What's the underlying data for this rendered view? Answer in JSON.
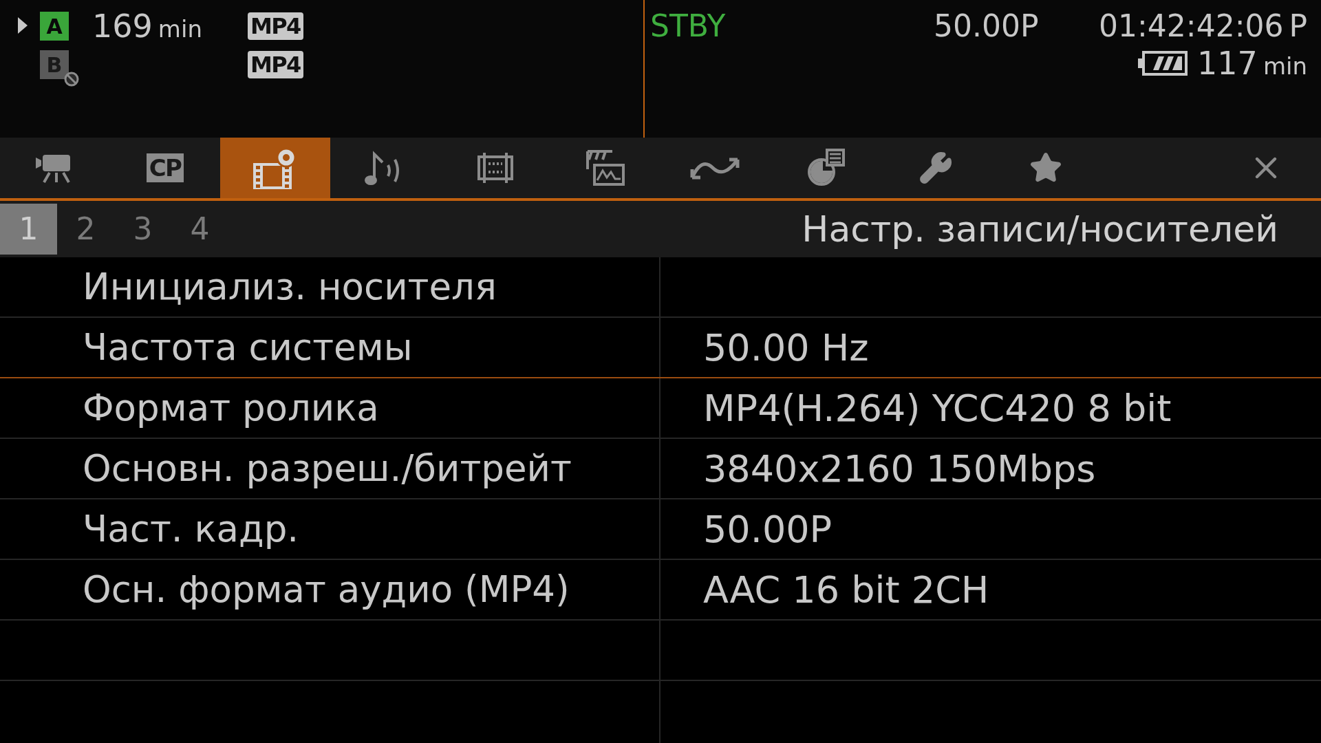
{
  "status": {
    "media": [
      {
        "slot": "A",
        "active": true,
        "disabled": false,
        "remaining": "169",
        "unit": "min",
        "format": "MP4"
      },
      {
        "slot": "B",
        "active": false,
        "disabled": true,
        "format": "MP4"
      }
    ],
    "mode": "STBY",
    "frame_rate": "50.00P",
    "timecode": "01:42:42:06",
    "timecode_suffix": "P",
    "battery": {
      "remaining": "117",
      "unit": "min"
    }
  },
  "menu_tabs": [
    {
      "kind": "camera",
      "selected": false
    },
    {
      "kind": "text",
      "label": "CP",
      "selected": false
    },
    {
      "kind": "media-settings",
      "selected": true
    },
    {
      "kind": "audio",
      "selected": false
    },
    {
      "kind": "frame",
      "selected": false
    },
    {
      "kind": "monitor",
      "selected": false
    },
    {
      "kind": "curve",
      "selected": false
    },
    {
      "kind": "target-list",
      "selected": false
    },
    {
      "kind": "wrench",
      "selected": false
    },
    {
      "kind": "star",
      "selected": false
    }
  ],
  "pages": [
    {
      "label": "1",
      "selected": true
    },
    {
      "label": "2",
      "selected": false
    },
    {
      "label": "3",
      "selected": false
    },
    {
      "label": "4",
      "selected": false
    }
  ],
  "section_title": "Настр. записи/носителей",
  "rows": [
    {
      "label": "Инициализ. носителя",
      "selected": false
    },
    {
      "label": "Частота системы",
      "value": "50.00 Hz",
      "selected": true
    },
    {
      "label": "Формат ролика",
      "value": "MP4(H.264) YCC420 8 bit",
      "selected": false
    },
    {
      "label": "Основн. разреш./битрейт",
      "value": "3840x2160 150Mbps",
      "selected": false
    },
    {
      "label": "Част. кадр.",
      "value": "50.00P",
      "selected": false
    },
    {
      "label": "Осн. формат аудио (MP4)",
      "value": "AAC 16 bit 2CH",
      "selected": false
    }
  ]
}
